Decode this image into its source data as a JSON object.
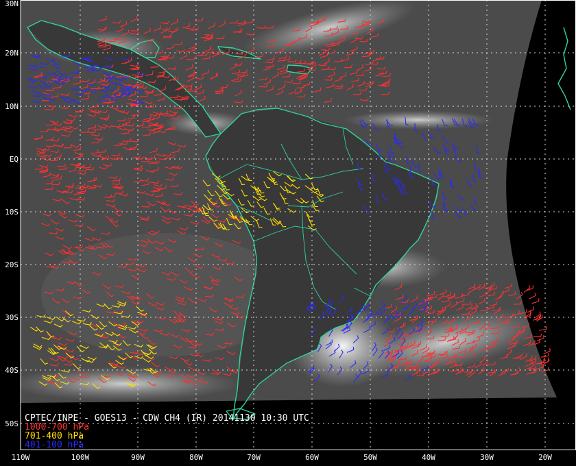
{
  "colors": {
    "background": "#000000",
    "earth": "#4a4a4a",
    "land": "#3a3a3a",
    "coast": "#2fd59a",
    "grid": "#dcdcdc",
    "cloud": "#e8e8e8",
    "low_level": "#ff3030",
    "mid_level": "#ffe000",
    "high_level": "#2a2aff",
    "caption": "#ffffff"
  },
  "caption": {
    "title": "CPTEC/INPE - GOES13 - CDW CH4 (IR) 20141130 10:30 UTC",
    "legend": [
      {
        "label": "1000-700 hPa",
        "color_key": "low_level"
      },
      {
        "label": "701-400 hPa",
        "color_key": "mid_level"
      },
      {
        "label": "401-100 hPa",
        "color_key": "high_level"
      }
    ]
  },
  "grid": {
    "lat_labels": [
      "30N",
      "20N",
      "10N",
      "EQ",
      "10S",
      "20S",
      "30S",
      "40S",
      "50S"
    ],
    "lon_labels": [
      "110W",
      "100W",
      "90W",
      "80W",
      "70W",
      "60W",
      "50W",
      "40W",
      "30W",
      "20W"
    ]
  },
  "wind_fields": [
    {
      "level": "low_level",
      "area": "tropical-north-atlantic"
    },
    {
      "level": "low_level",
      "area": "eastern-pacific"
    },
    {
      "level": "low_level",
      "area": "southeast-pacific"
    },
    {
      "level": "low_level",
      "area": "south-atlantic"
    },
    {
      "level": "mid_level",
      "area": "amazon-andes"
    },
    {
      "level": "mid_level",
      "area": "south-pacific"
    },
    {
      "level": "high_level",
      "area": "uruguay-south-brazil"
    },
    {
      "level": "high_level",
      "area": "northeast-brazil"
    },
    {
      "level": "high_level",
      "area": "caribbean"
    }
  ]
}
